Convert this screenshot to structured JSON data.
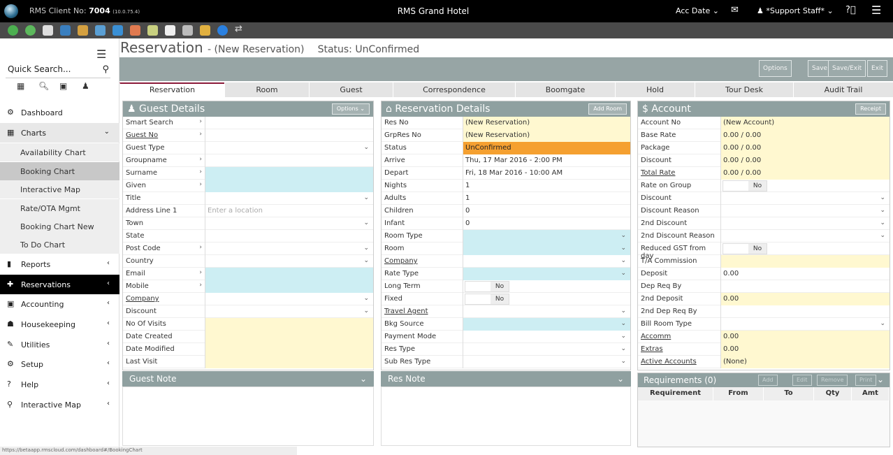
{
  "topbar": {
    "client_label": "RMS Client No:",
    "client_no": "7004",
    "ip": "(10.0.75.4)",
    "hotel": "RMS Grand Hotel",
    "acc_date": "Acc Date ⌄",
    "user": "*Support Staff* ⌄"
  },
  "sidebar": {
    "search_placeholder": "Quick Search...",
    "nav": [
      {
        "label": "Dashboard",
        "icon": "⚙",
        "chev": ""
      },
      {
        "label": "Charts",
        "icon": "▦",
        "chev": "⌄"
      }
    ],
    "subs": [
      "Availability Chart",
      "Booking Chart",
      "Interactive Map",
      "Rate/OTA Mgmt",
      "Booking Chart New",
      "To Do Chart"
    ],
    "nav2": [
      {
        "label": "Reports",
        "icon": "▮",
        "chev": "‹"
      },
      {
        "label": "Reservations",
        "icon": "✚",
        "chev": "‹"
      },
      {
        "label": "Accounting",
        "icon": "▣",
        "chev": "‹"
      },
      {
        "label": "Housekeeping",
        "icon": "☗",
        "chev": "‹"
      },
      {
        "label": "Utilities",
        "icon": "✎",
        "chev": "‹"
      },
      {
        "label": "Setup",
        "icon": "⚙",
        "chev": "‹"
      },
      {
        "label": "Help",
        "icon": "?",
        "chev": "‹"
      },
      {
        "label": "Interactive Map",
        "icon": "⚲",
        "chev": "‹"
      }
    ]
  },
  "page": {
    "title": "Reservation",
    "subtitle": "- (New Reservation)",
    "status": "Status: UnConfirmed"
  },
  "actions": [
    "Options",
    "Save",
    "Save/Exit",
    "Exit"
  ],
  "tabs": [
    "Reservation",
    "Room",
    "Guest",
    "Correspondence",
    "Boomgate",
    "Hold",
    "Tour Desk",
    "Audit Trail"
  ],
  "guest": {
    "title": "Guest Details",
    "button": "Options ⌄",
    "rows": [
      {
        "l": "Smart Search",
        "a": 1
      },
      {
        "l": "Guest No",
        "u": 1,
        "a": 1
      },
      {
        "l": "Guest Type",
        "d": 1
      },
      {
        "l": "Groupname",
        "a": 1
      },
      {
        "l": "Surname",
        "a": 1,
        "bg": "blue"
      },
      {
        "l": "Given",
        "a": 1,
        "bg": "blue"
      },
      {
        "l": "Title",
        "d": 1
      },
      {
        "l": "Address Line 1",
        "p": "Enter a location"
      },
      {
        "l": "Town",
        "d": 1
      },
      {
        "l": "State"
      },
      {
        "l": "Post Code",
        "a": 1,
        "d": 1
      },
      {
        "l": "Country",
        "d": 1
      },
      {
        "l": "Email",
        "a": 1,
        "bg": "blue"
      },
      {
        "l": "Mobile",
        "a": 1,
        "bg": "blue"
      },
      {
        "l": "Company",
        "u": 1,
        "d": 1
      },
      {
        "l": "Discount",
        "d": 1
      },
      {
        "l": "No Of Visits",
        "bg": "yel"
      },
      {
        "l": "Date Created",
        "bg": "yel"
      },
      {
        "l": "Date Modified",
        "bg": "yel"
      },
      {
        "l": "Last Visit",
        "bg": "yel"
      }
    ]
  },
  "res": {
    "title": "Reservation Details",
    "button": "Add Room",
    "rows": [
      {
        "l": "Res No",
        "v": "(New Reservation)",
        "bg": "yel"
      },
      {
        "l": "GrpRes No",
        "v": "(New Reservation)",
        "bg": "yel"
      },
      {
        "l": "Status",
        "v": "UnConfirmed",
        "bg": "org"
      },
      {
        "l": "Arrive",
        "v": "Thu, 17 Mar 2016 - 2:00 PM"
      },
      {
        "l": "Depart",
        "v": "Fri, 18 Mar 2016 - 10:00 AM"
      },
      {
        "l": "Nights",
        "v": "1"
      },
      {
        "l": "Adults",
        "v": "1"
      },
      {
        "l": "Children",
        "v": "0"
      },
      {
        "l": "Infant",
        "v": "0"
      },
      {
        "l": "Room Type",
        "d": 1,
        "bg": "blue"
      },
      {
        "l": "Room",
        "d": 1,
        "bg": "blue"
      },
      {
        "l": "Company",
        "u": 1,
        "d": 1
      },
      {
        "l": "Rate Type",
        "d": 1,
        "bg": "blue"
      },
      {
        "l": "Long Term",
        "t": "No"
      },
      {
        "l": "Fixed",
        "t": "No"
      },
      {
        "l": "Travel Agent",
        "u": 1,
        "d": 1
      },
      {
        "l": "Bkg Source",
        "d": 1,
        "bg": "blue"
      },
      {
        "l": "Payment Mode",
        "d": 1
      },
      {
        "l": "Res Type",
        "d": 1
      },
      {
        "l": "Sub Res Type",
        "d": 1
      }
    ]
  },
  "account": {
    "title": "Account",
    "button": "Receipt",
    "rows": [
      {
        "l": "Account No",
        "v": "(New Account)",
        "bg": "yel"
      },
      {
        "l": "Base Rate",
        "v": "0.00 / 0.00",
        "bg": "yel"
      },
      {
        "l": "Package",
        "v": "0.00 / 0.00",
        "bg": "yel"
      },
      {
        "l": "Discount",
        "v": "0.00 / 0.00",
        "bg": "yel"
      },
      {
        "l": "Total Rate",
        "u": 1,
        "v": "0.00 / 0.00",
        "bg": "yel"
      },
      {
        "l": "Rate on Group",
        "t": "No"
      },
      {
        "l": "Discount",
        "d": 1
      },
      {
        "l": "Discount Reason",
        "d": 1
      },
      {
        "l": "2nd Discount",
        "d": 1
      },
      {
        "l": "2nd Discount Reason",
        "d": 1
      },
      {
        "l": "Reduced GST from day",
        "t": "No"
      },
      {
        "l": "T/A Commission",
        "bg": "yel"
      },
      {
        "l": "Deposit",
        "v": "0.00"
      },
      {
        "l": "Dep Req By"
      },
      {
        "l": "2nd Deposit",
        "v": "0.00",
        "bg": "yel"
      },
      {
        "l": "2nd Dep Req By"
      },
      {
        "l": "Bill Room Type",
        "d": 1
      },
      {
        "l": "Accomm",
        "u": 1,
        "v": "0.00",
        "bg": "yel"
      },
      {
        "l": "Extras",
        "u": 1,
        "v": "0.00",
        "bg": "yel"
      },
      {
        "l": "Active Accounts",
        "u": 1,
        "v": "(None)",
        "bg": "yel"
      }
    ]
  },
  "notes": {
    "guest": "Guest Note",
    "res": "Res Note"
  },
  "requirements": {
    "title": "Requirements (0)",
    "buttons": [
      "Add",
      "Edit",
      "Remove",
      "Print"
    ],
    "columns": [
      "Requirement",
      "From",
      "To",
      "Qty",
      "Amt"
    ]
  },
  "statusbar": "https://betaapp.rmscloud.com/dashboard#/BookingChart"
}
